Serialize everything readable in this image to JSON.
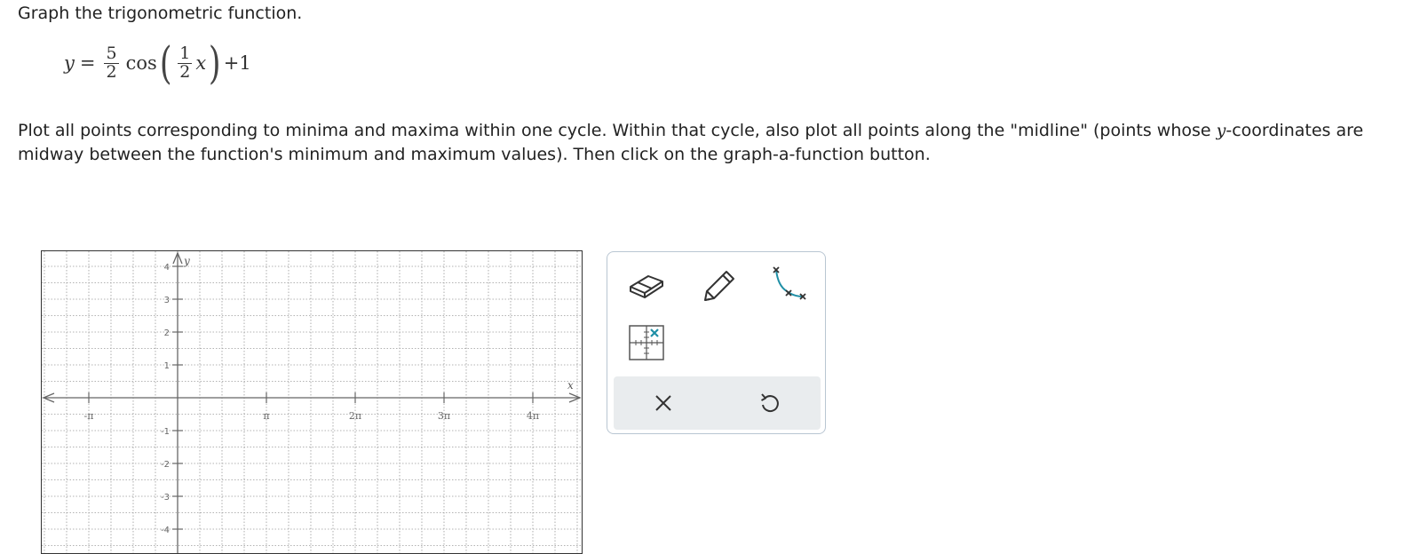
{
  "prompt": "Graph the trigonometric function.",
  "equation": {
    "lhs": "y",
    "equals": "=",
    "coef_num": "5",
    "coef_den": "2",
    "func": "cos",
    "arg_num": "1",
    "arg_den": "2",
    "arg_var": "x",
    "tail": "+1"
  },
  "instructions": {
    "part1": "Plot all points corresponding to minima and maxima within one cycle. Within that cycle, also plot all points along the \"midline\" (points whose ",
    "var": "y",
    "part2": "-coordinates are midway between the function's minimum and maximum values). Then click on the graph-a-function button."
  },
  "graph": {
    "x_axis_label": "x",
    "y_axis_label": "y",
    "x_ticks": [
      "-π",
      "π",
      "2π",
      "3π",
      "4π"
    ],
    "y_ticks": [
      "4",
      "3",
      "2",
      "1",
      "-1",
      "-2",
      "-3",
      "-4"
    ],
    "colors": {
      "axis": "#666666",
      "grid": "#9a9a9a",
      "border": "#333333"
    }
  },
  "tools": {
    "eraser": "eraser-tool",
    "pencil": "pencil-tool",
    "curve": "graph-a-function-tool",
    "points": "plot-points-tool",
    "clear": "clear-button",
    "undo": "undo-button"
  },
  "toolbox_colors": {
    "accent": "#1f8fa6",
    "icon": "#333333",
    "action_bar": "#e9ecee"
  }
}
